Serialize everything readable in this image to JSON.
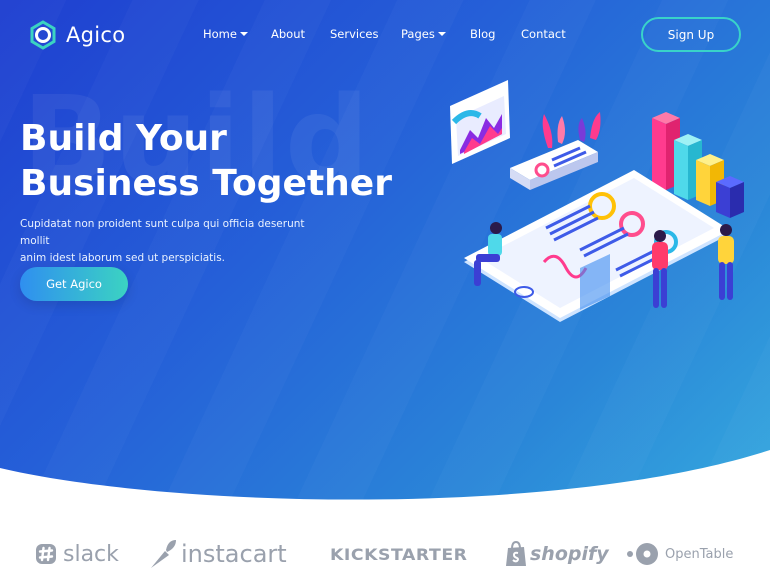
{
  "brand": {
    "name": "Agico"
  },
  "nav": {
    "items": [
      {
        "label": "Home",
        "dropdown": true
      },
      {
        "label": "About",
        "dropdown": false
      },
      {
        "label": "Services",
        "dropdown": false
      },
      {
        "label": "Pages",
        "dropdown": true
      },
      {
        "label": "Blog",
        "dropdown": false
      },
      {
        "label": "Contact",
        "dropdown": false
      }
    ],
    "signup_label": "Sign Up"
  },
  "hero": {
    "watermark": "Build",
    "headline_line1": "Build Your",
    "headline_line2": "Business Together",
    "description_line1": "Cupidatat non proident sunt culpa qui officia deserunt mollit",
    "description_line2": "anim idest laborum sed ut perspiciatis.",
    "cta_label": "Get Agico"
  },
  "partners": [
    {
      "name": "slack",
      "icon": "slack-icon"
    },
    {
      "name": "instacart",
      "icon": "carrot-icon"
    },
    {
      "name": "KICKSTARTER",
      "icon": ""
    },
    {
      "name": "shopify",
      "icon": "shopping-bag-icon"
    },
    {
      "name": "OpenTable",
      "icon": "opentable-dots-icon"
    }
  ],
  "colors": {
    "hero_gradient_start": "#1f3fd0",
    "hero_gradient_end": "#35a9de",
    "accent_teal": "#39d3c9",
    "partner_logo_gray": "#9aa1ad"
  }
}
